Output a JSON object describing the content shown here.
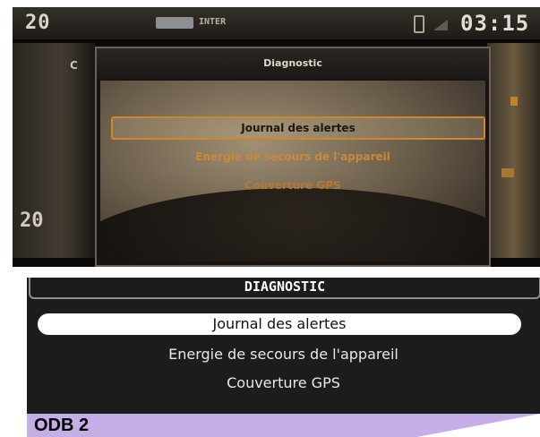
{
  "status_bar": {
    "temperature": "20",
    "source": "INTER",
    "clock": "03:15"
  },
  "screen": {
    "left_label": "C",
    "left_value": "20"
  },
  "dialog": {
    "title": "Diagnostic",
    "items": [
      "Journal des alertes",
      "Energie de secours de l'appareil",
      "Couverture GPS"
    ],
    "selected_index": 0
  },
  "menu": {
    "title": "DIAGNOSTIC",
    "items": [
      "Journal des alertes",
      "Energie de secours de l'appareil",
      "Couverture GPS"
    ],
    "selected_index": 0
  },
  "caption": "ODB 2",
  "colors": {
    "caption_band": "#c5aee5",
    "dialog_accent": "#c88a2a",
    "menu_background": "#1c1c1c"
  },
  "icons": [
    "phone-icon",
    "signal-icon",
    "radio-chip-icon"
  ]
}
